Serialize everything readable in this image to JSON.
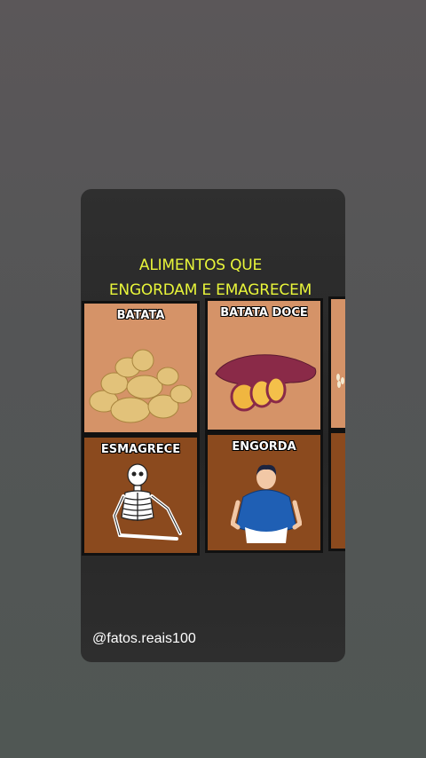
{
  "title": {
    "line1": "ALIMENTOS QUE",
    "line2": "ENGORDAM E EMAGRECEM"
  },
  "panels": {
    "top_left_label": "BATATA",
    "top_middle_label": "BATATA DOCE",
    "bottom_left_label": "ESMAGRECE",
    "bottom_middle_label": "ENGORDA"
  },
  "watermark": "@fatos.reais100",
  "colors": {
    "title": "#e8f53a",
    "panel_light": "#d59368",
    "panel_dark": "#8b4a1e"
  }
}
